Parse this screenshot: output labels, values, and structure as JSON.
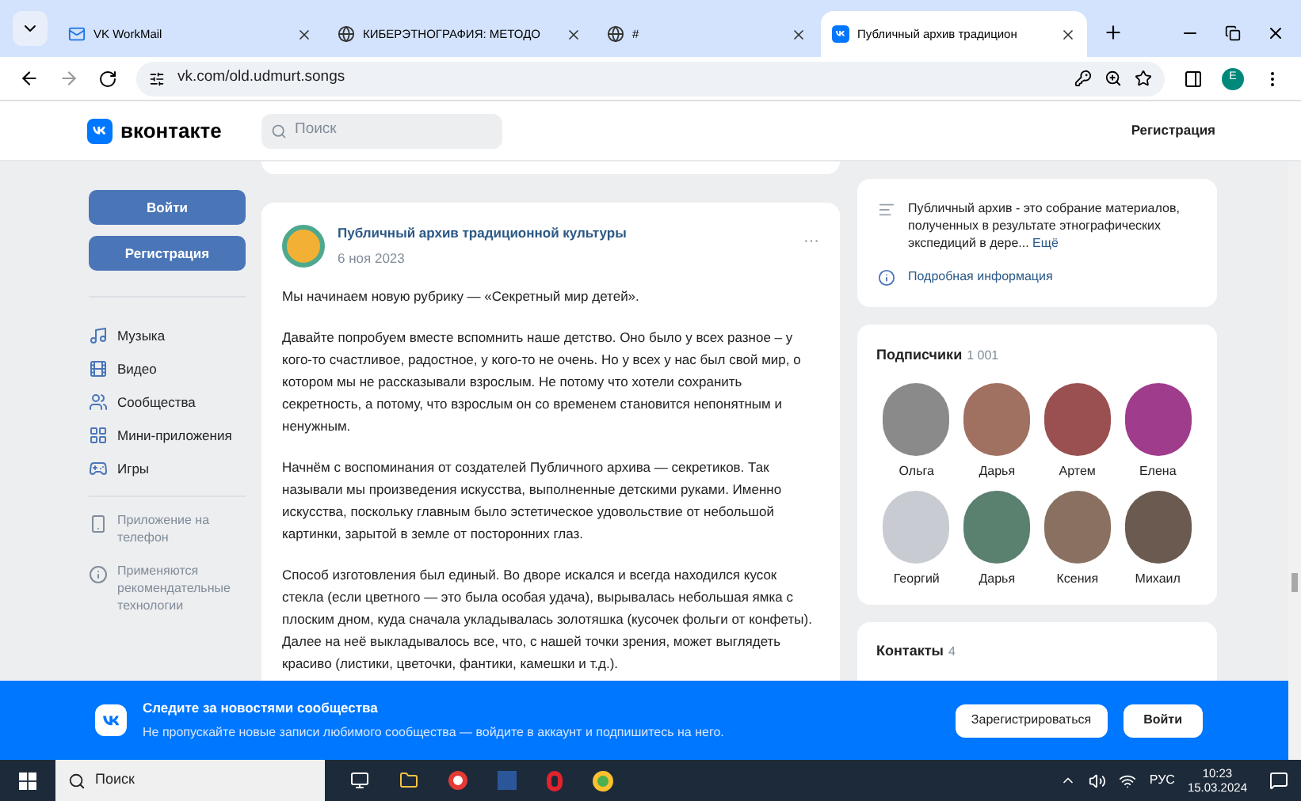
{
  "browser": {
    "tabs": [
      {
        "title": "VK WorkMail",
        "selected": false
      },
      {
        "title": "КИБЕРЭТНОГРАФИЯ: МЕТОДО",
        "selected": false
      },
      {
        "title": "#",
        "selected": false
      },
      {
        "title": "Публичный архив традицион",
        "selected": true
      }
    ],
    "url": "vk.com/old.udmurt.songs",
    "profile_initial": "E"
  },
  "header": {
    "logo_text": "вконтакте",
    "search_placeholder": "Поиск",
    "register_link": "Регистрация"
  },
  "sidebar": {
    "login_button": "Войти",
    "register_button": "Регистрация",
    "items": [
      {
        "kind": "music",
        "label": "Музыка"
      },
      {
        "kind": "video",
        "label": "Видео"
      },
      {
        "kind": "groups",
        "label": "Сообщества"
      },
      {
        "kind": "apps",
        "label": "Мини-приложения"
      },
      {
        "kind": "games",
        "label": "Игры"
      }
    ],
    "extras": [
      {
        "kind": "phone",
        "label": "Приложение на телефон"
      },
      {
        "kind": "info",
        "label": "Применяются рекомендательные технологии"
      }
    ]
  },
  "post": {
    "author": "Публичный архив традиционной культуры",
    "date": "6 ноя 2023",
    "menu": "···",
    "paragraphs": [
      "Мы начинаем новую рубрику — «Секретный мир детей».",
      "Давайте попробуем вместе вспомнить наше детство. Оно было у всех разное – у кого-то счастливое, радостное, у кого-то не очень. Но у всех у нас был свой мир, о котором мы не рассказывали взрослым. Не потому что хотели сохранить секретность, а потому, что взрослым он со временем становится непонятным и ненужным.",
      "Начнём с воспоминания от создателей Публичного архива — секретиков. Так называли мы произведения искусства, выполненные детскими руками. Именно искусства, поскольку главным было эстетическое удовольствие от небольшой картинки, зарытой в земле от посторонних глаз.",
      "Способ изготовления был единый. Во дворе искался и всегда находился кусок стекла (если цветного — это была особая удача), вырывалась небольшая ямка с плоским дном, куда сначала укладывалась золотяшка (кусочек фольги от конфеты). Далее на неё выкладывалось все, что, с нашей точки зрения, может выглядеть красиво (листики, цветочки, фантики, камешки и т.д.)."
    ]
  },
  "about": {
    "text": "Публичный архив - это собрание материалов, полученных в результате этнографических экспедиций в дере...",
    "more_link": "Ещё",
    "details_link": "Подробная информация"
  },
  "subscribers": {
    "title": "Подписчики",
    "count": "1 001",
    "people": [
      {
        "name": "Ольга",
        "color": "#8a8a8a"
      },
      {
        "name": "Дарья",
        "color": "#a07060"
      },
      {
        "name": "Артем",
        "color": "#9a5050"
      },
      {
        "name": "Елена",
        "color": "#a03c8c"
      },
      {
        "name": "Георгий",
        "color": "#c8ccd2"
      },
      {
        "name": "Дарья",
        "color": "#5a8070"
      },
      {
        "name": "Ксения",
        "color": "#8a7060"
      },
      {
        "name": "Михаил",
        "color": "#6a5a50"
      }
    ]
  },
  "contacts": {
    "title": "Контакты",
    "count": "4"
  },
  "banner": {
    "title": "Следите за новостями сообщества",
    "subtitle": "Не пропускайте новые записи любимого сообщества — войдите в аккаунт и подпишитесь на него.",
    "register_button": "Зарегистрироваться",
    "login_button": "Войти"
  },
  "taskbar": {
    "search_placeholder": "Поиск",
    "language": "РУС",
    "time": "10:23",
    "date": "15.03.2024"
  }
}
